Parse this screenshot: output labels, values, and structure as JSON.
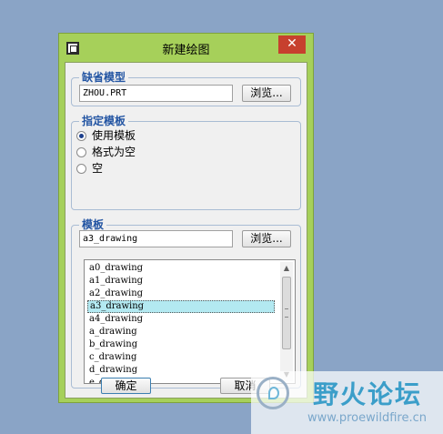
{
  "dialog": {
    "title": "新建绘图",
    "close_glyph": "✕"
  },
  "default_model": {
    "label": "缺省模型",
    "value": "ZHOU.PRT",
    "browse_label": "浏览..."
  },
  "specify_template": {
    "label": "指定模板",
    "options": [
      {
        "label": "使用模板",
        "checked": true
      },
      {
        "label": "格式为空",
        "checked": false
      },
      {
        "label": "空",
        "checked": false
      }
    ]
  },
  "template": {
    "label": "模板",
    "value": "a3_drawing",
    "browse_label": "浏览...",
    "list": [
      "a0_drawing",
      "a1_drawing",
      "a2_drawing",
      "a3_drawing",
      "a4_drawing",
      "a_drawing",
      "b_drawing",
      "c_drawing",
      "d_drawing",
      "e_drawing"
    ],
    "selected": "a3_drawing"
  },
  "buttons": {
    "ok": "确定",
    "cancel": "取消"
  },
  "watermark": {
    "title": "野火论坛",
    "url": "www.proewildfire.cn"
  },
  "colors": {
    "frame": "#a6d05a",
    "close": "#c7402e",
    "group_label": "#2355a3",
    "selection": "#b3e9f1"
  }
}
